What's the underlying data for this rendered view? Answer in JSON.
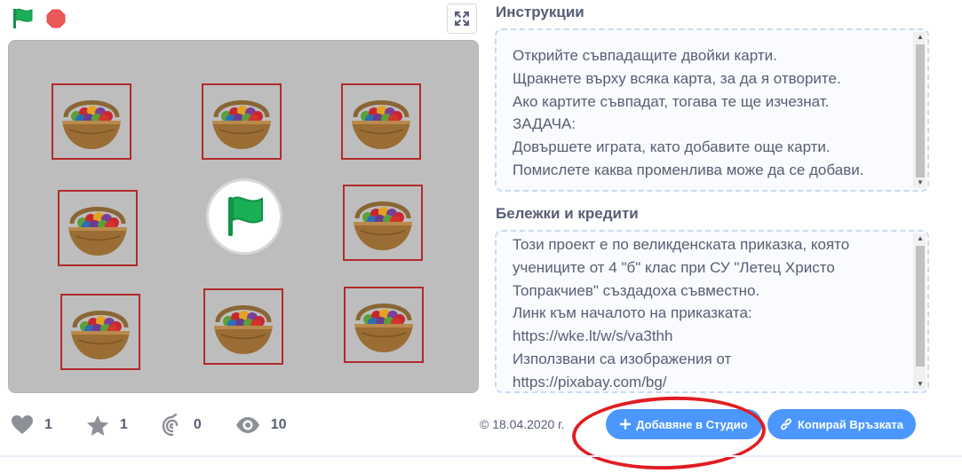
{
  "instructions": {
    "heading": "Инструкции",
    "lines": [
      "Открийте съвпадащите двойки карти.",
      "Щракнете върху всяка карта, за да я отворите.",
      "Ако картите съвпадат, тогава те ще изчезнат.",
      "ЗАДАЧА:",
      "Довършете играта, като добавите още карти.",
      "Помислете каква променлива може да се добави."
    ]
  },
  "notes": {
    "heading": "Бележки и кредити",
    "lines": [
      "Този проект е по великденската приказка, която",
      "учениците от 4 \"б\" клас при СУ \"Летец Христо",
      "Топракчиев\" създадоха съвместно.",
      "Линк към началото на приказката:",
      "https://wke.lt/w/s/va3thh",
      "Използвани са изображения от",
      "https://pixabay.com/bg/"
    ]
  },
  "stats": {
    "loves": "1",
    "favorites": "1",
    "remixes": "0",
    "views": "10"
  },
  "date": "© 18.04.2020 г.",
  "buttons": {
    "add_to_studio": "Добавяне в Студио",
    "copy_link": "Копирай Връзката"
  },
  "icons": {
    "green_flag": "green-flag-icon",
    "stop": "stop-icon",
    "fullscreen": "fullscreen-icon",
    "heart": "heart-icon",
    "star": "star-icon",
    "remix": "remix-icon",
    "eye": "eye-icon",
    "plus": "plus-icon",
    "link": "link-icon"
  },
  "colors": {
    "accent": "#4c97ff",
    "flag_green": "#1aae55",
    "stop_red": "#ec5959",
    "card_border": "#b22a2a",
    "annotation_red": "#e21c22",
    "stage_bg": "#bdbdbd"
  }
}
